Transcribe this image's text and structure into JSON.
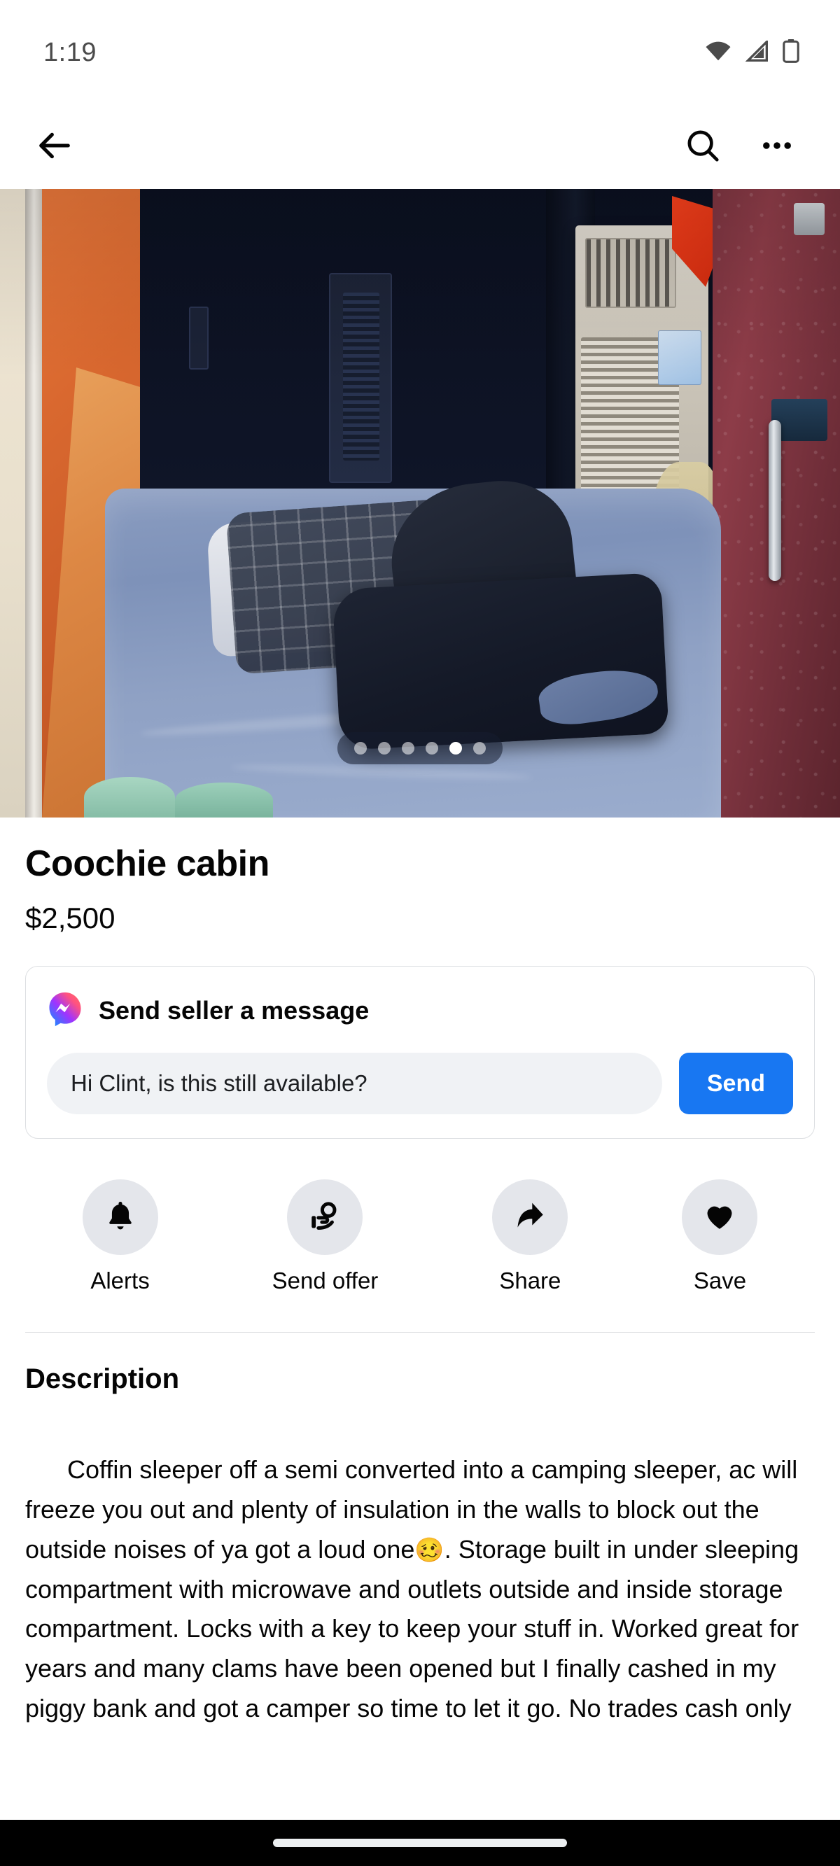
{
  "status_bar": {
    "time": "1:19",
    "icons": [
      "wifi-icon",
      "cellular-signal-icon",
      "battery-icon"
    ]
  },
  "nav_bar": {
    "back_icon": "back-arrow-icon",
    "search_icon": "search-icon",
    "more_icon": "more-options-icon"
  },
  "listing": {
    "photo_alt": "Truck coffin sleeper cabin interior with bed, AC unit and orange foam panel",
    "carousel": {
      "total": 6,
      "active_index": 5
    },
    "title": "Coochie cabin",
    "price": "$2,500"
  },
  "message_card": {
    "icon": "messenger-icon",
    "heading": "Send seller a message",
    "input_value": "Hi Clint, is this still available?",
    "input_placeholder": "Hi Clint, is this still available?",
    "send_label": "Send",
    "send_color": "#1877f2"
  },
  "actions": [
    {
      "label": "Alerts",
      "icon": "bell-icon"
    },
    {
      "label": "Send offer",
      "icon": "hand-offer-icon"
    },
    {
      "label": "Share",
      "icon": "share-arrow-icon"
    },
    {
      "label": "Save",
      "icon": "heart-icon"
    }
  ],
  "description": {
    "heading": "Description",
    "text_before_emoji": "Coffin sleeper off a semi converted into a camping sleeper, ac will freeze you out and plenty of insulation in the walls to block out the outside noises of ya got a loud one",
    "emoji": "🥴",
    "text_after_emoji": ". Storage built in under sleeping compartment with microwave and outlets outside and inside storage compartment. Locks with a key to keep your stuff in. Worked great for years and many clams have been opened but I finally cashed in my piggy bank and got a camper so time to let it go. No trades cash only"
  },
  "gesture_bar": {
    "home_indicator": "home-indicator"
  }
}
